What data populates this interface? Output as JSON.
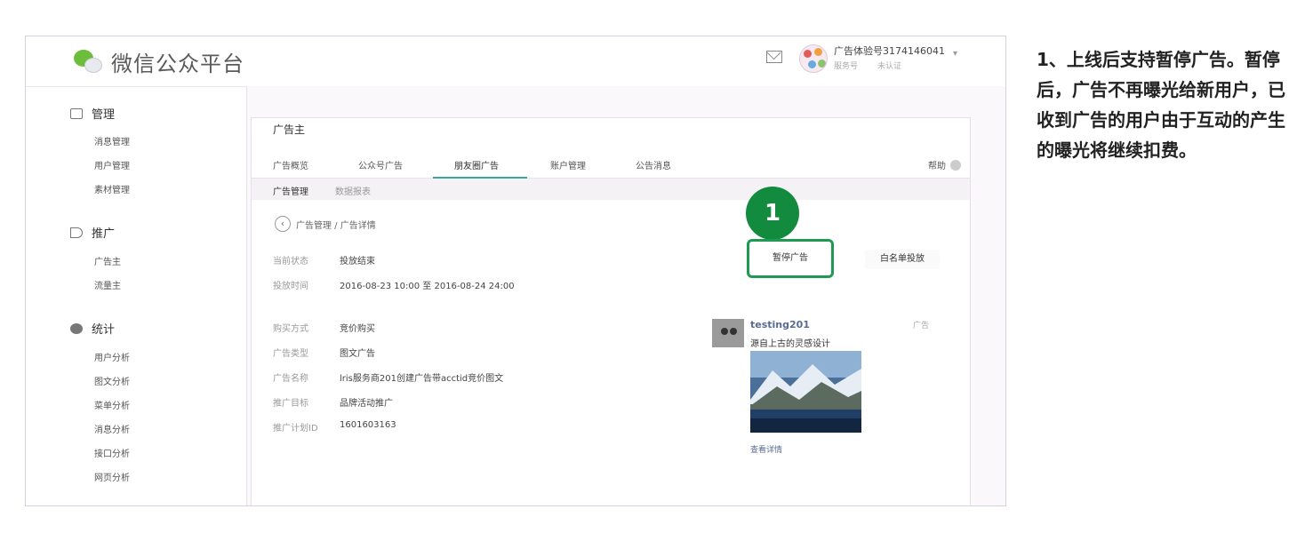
{
  "header": {
    "logo_text": "微信公众平台",
    "account_name": "广告体验号3174146041",
    "account_type": "服务号",
    "account_verify": "未认证"
  },
  "sidebar": {
    "groups": [
      {
        "label": "管理",
        "items": [
          "消息管理",
          "用户管理",
          "素材管理"
        ]
      },
      {
        "label": "推广",
        "items": [
          "广告主",
          "流量主"
        ]
      },
      {
        "label": "统计",
        "items": [
          "用户分析",
          "图文分析",
          "菜单分析",
          "消息分析",
          "接口分析",
          "网页分析"
        ]
      }
    ]
  },
  "content": {
    "section_title": "广告主",
    "tabs": [
      "广告概览",
      "公众号广告",
      "朋友圈广告",
      "账户管理",
      "公告消息"
    ],
    "active_tab": "朋友圈广告",
    "help_label": "帮助",
    "subtabs": [
      "广告管理",
      "数据报表"
    ],
    "detail_crumb": "广告管理 / 广告详情",
    "status_rows": [
      {
        "label": "当前状态",
        "value": "投放结束"
      },
      {
        "label": "投放时间",
        "value": "2016-08-23 10:00 至 2016-08-24 24:00"
      }
    ],
    "info_rows": [
      {
        "label": "购买方式",
        "value": "竞价购买"
      },
      {
        "label": "广告类型",
        "value": "图文广告"
      },
      {
        "label": "广告名称",
        "value": "lris服务商201创建广告带acctid竞价图文"
      },
      {
        "label": "推广目标",
        "value": "品牌活动推广"
      },
      {
        "label": "推广计划ID",
        "value": "1601603163"
      }
    ],
    "step_number": "1",
    "pause_button": "暂停广告",
    "whitelist_button": "白名单投放",
    "preview": {
      "name": "testing201",
      "tag": "广告",
      "text": "源自上古的灵感设计",
      "more": "查看详情"
    }
  },
  "annotation": "1、上线后支持暂停广告。暂停后，广告不再曝光给新用户，已收到广告的用户由于互动的产生的曝光将继续扣费。",
  "colors": {
    "accent": "#138b3f",
    "tab_underline": "#3aa79a",
    "link": "#576b95"
  }
}
